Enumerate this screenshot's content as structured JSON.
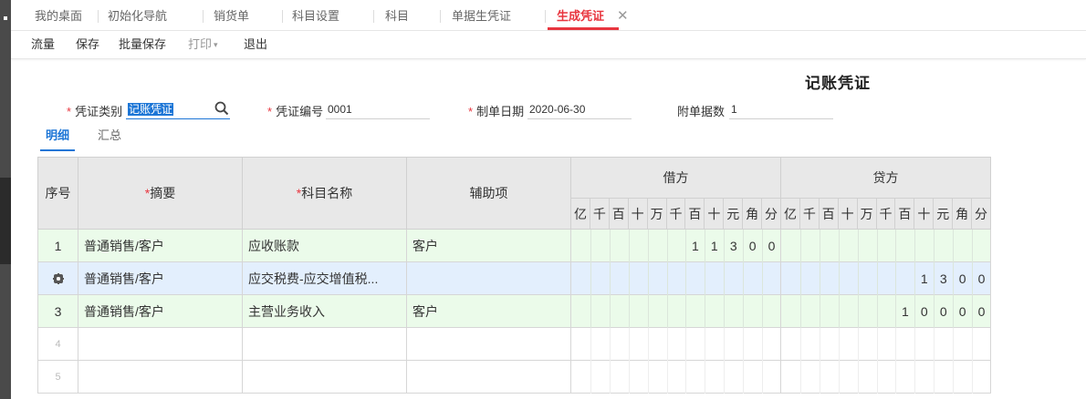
{
  "tabs": [
    {
      "label": "我的桌面"
    },
    {
      "label": "初始化导航"
    },
    {
      "label": "销货单"
    },
    {
      "label": "科目设置"
    },
    {
      "label": "科目"
    },
    {
      "label": "单据生凭证"
    },
    {
      "label": "生成凭证",
      "active": true
    }
  ],
  "toolbar": {
    "flow": "流量",
    "save": "保存",
    "batch_save": "批量保存",
    "print": "打印",
    "exit": "退出"
  },
  "title": "记账凭证",
  "form": {
    "type_label": "凭证类别",
    "type_value": "记账凭证",
    "number_label": "凭证编号",
    "number_value": "0001",
    "date_label": "制单日期",
    "date_value": "2020-06-30",
    "attach_label": "附单据数",
    "attach_value": "1"
  },
  "subtabs": {
    "detail": "明细",
    "summary": "汇总"
  },
  "table": {
    "headers": {
      "seq": "序号",
      "summary": "摘要",
      "account": "科目名称",
      "aux": "辅助项",
      "debit": "借方",
      "credit": "贷方"
    },
    "units": [
      "亿",
      "千",
      "百",
      "十",
      "万",
      "千",
      "百",
      "十",
      "元",
      "角",
      "分"
    ],
    "rows": [
      {
        "seq": "1",
        "summary": "普通销售/客户",
        "account": "应收账款",
        "aux": "客户",
        "debit": "11300",
        "credit": ""
      },
      {
        "seq": "",
        "summary": "普通销售/客户",
        "account": "应交税费-应交增值税...",
        "aux": "",
        "debit": "",
        "credit": "1300"
      },
      {
        "seq": "3",
        "summary": "普通销售/客户",
        "account": "主营业务收入",
        "aux": "客户",
        "debit": "",
        "credit": "10000"
      },
      {
        "seq": "4",
        "summary": "",
        "account": "",
        "aux": "",
        "debit": "",
        "credit": ""
      },
      {
        "seq": "5",
        "summary": "",
        "account": "",
        "aux": "",
        "debit": "",
        "credit": ""
      }
    ]
  },
  "colors": {
    "accent": "#e8363f",
    "link": "#1d76d6",
    "row_green": "#ebfbea",
    "row_blue": "#e3effd"
  }
}
